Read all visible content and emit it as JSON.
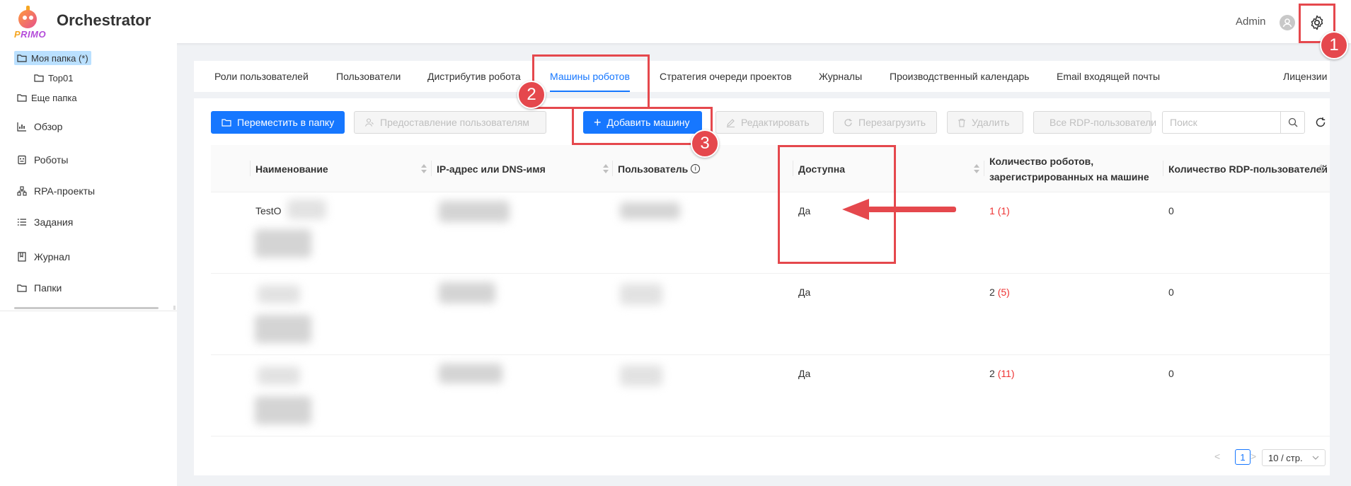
{
  "header": {
    "logo_text": "RIMO",
    "title": "Orchestrator",
    "user": "Admin",
    "avatar_icon": "user-icon",
    "settings_icon": "gear-icon"
  },
  "sidebar": {
    "tree": [
      {
        "label": "Моя папка (*)",
        "icon": "folder-icon",
        "selected": true
      },
      {
        "label": "Top01",
        "icon": "folder-icon"
      },
      {
        "label": "Еще папка",
        "icon": "folder-icon"
      }
    ],
    "nav": [
      {
        "label": "Обзор",
        "icon": "bar-chart-icon"
      },
      {
        "label": "Роботы",
        "icon": "robot-icon"
      },
      {
        "label": "RPA-проекты",
        "icon": "cluster-icon"
      },
      {
        "label": "Задания",
        "icon": "list-icon"
      },
      {
        "label": "Журнал",
        "icon": "book-icon"
      },
      {
        "label": "Папки",
        "icon": "folder-icon"
      }
    ]
  },
  "tabs": [
    {
      "label": "Роли пользователей"
    },
    {
      "label": "Пользователи"
    },
    {
      "label": "Дистрибутив робота"
    },
    {
      "label": "Машины роботов",
      "active": true
    },
    {
      "label": "Стратегия очереди проектов"
    },
    {
      "label": "Журналы"
    },
    {
      "label": "Производственный календарь"
    },
    {
      "label": "Email входящей почты"
    },
    {
      "label": "Лицензии"
    }
  ],
  "toolbar": {
    "move_to_folder": "Переместить в папку",
    "grant_users": "Предоставление пользователям",
    "add_machine": "Добавить машину",
    "edit": "Редактировать",
    "restart": "Перезагрузить",
    "delete": "Удалить",
    "all_rdp_users": "Все RDP-пользователи",
    "search_placeholder": "Поиск"
  },
  "table": {
    "columns": {
      "name": "Наименование",
      "ip": "IP-адрес или DNS-имя",
      "user": "Пользователь",
      "available": "Доступна",
      "robots_line1": "Количество роботов,",
      "robots_line2": "зарегистрированных на машине",
      "rdp": "Количество RDP-пользователей"
    },
    "rows": [
      {
        "name": "TestO",
        "available": "Да",
        "robots": "1",
        "robots_extra": "(1)",
        "rdp": "0"
      },
      {
        "name": "",
        "available": "Да",
        "robots": "2",
        "robots_extra": "(5)",
        "rdp": "0"
      },
      {
        "name": "",
        "available": "Да",
        "robots": "2",
        "robots_extra": "(11)",
        "rdp": "0"
      }
    ]
  },
  "pagination": {
    "prev": "<",
    "page": "1",
    "next": ">",
    "page_size": "10 / стр."
  },
  "annotations": {
    "badge1": "1",
    "badge2": "2",
    "badge3": "3",
    "color": "#e5484d"
  },
  "colors": {
    "primary": "#1677ff",
    "selected_folder": "#bae0ff"
  }
}
